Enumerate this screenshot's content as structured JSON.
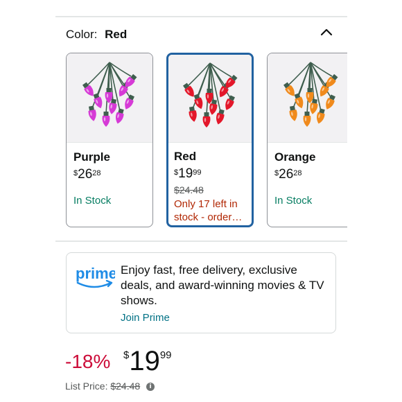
{
  "color_selector": {
    "label": "Color:",
    "selected": "Red",
    "collapse_icon": "chevron-up-icon"
  },
  "swatches": [
    {
      "name": "Purple",
      "currency": "$",
      "whole": "26",
      "fraction": "28",
      "list_price": "",
      "status": "In Stock",
      "bulb_color": "#d63ad6"
    },
    {
      "name": "Red",
      "currency": "$",
      "whole": "19",
      "fraction": "99",
      "list_price": "$24.48",
      "status": "Only 17 left in stock - order…",
      "bulb_color": "#e3172a"
    },
    {
      "name": "Orange",
      "currency": "$",
      "whole": "26",
      "fraction": "28",
      "list_price": "",
      "status": "In Stock",
      "bulb_color": "#f08a1c"
    }
  ],
  "prime": {
    "logo_text": "prime",
    "message": "Enjoy fast, free delivery, exclusive deals, and award-winning movies & TV shows.",
    "cta": "Join Prime"
  },
  "price": {
    "discount": "-18%",
    "currency": "$",
    "whole": "19",
    "fraction": "99",
    "list_price_label": "List Price:",
    "list_price": "$24.48"
  },
  "colors": {
    "accent_border": "#2162a1",
    "discount": "#cc0c39",
    "in_stock": "#067d62",
    "low_stock": "#b12704",
    "link": "#007185",
    "prime_blue": "#1f8ce6"
  }
}
